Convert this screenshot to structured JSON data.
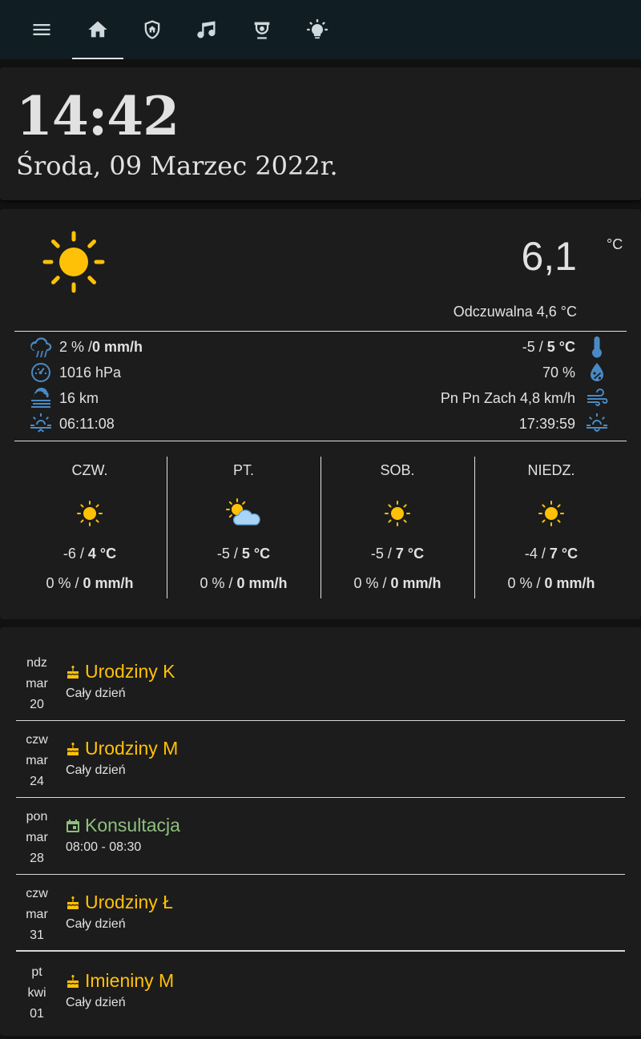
{
  "colors": {
    "topbar": "#101e24",
    "card": "#1c1c1c",
    "accent_yellow": "#ffc107",
    "accent_green": "#8fbf7f",
    "icon_blue": "#4a8ac4"
  },
  "nav": [
    {
      "icon": "menu-icon"
    },
    {
      "icon": "home-icon",
      "active": true
    },
    {
      "icon": "shield-home-icon"
    },
    {
      "icon": "music-note-icon"
    },
    {
      "icon": "cctv-icon"
    },
    {
      "icon": "lightbulb-icon"
    }
  ],
  "clock": {
    "time": "14:42",
    "date": "Środa, 09 Marzec 2022r."
  },
  "weather": {
    "condition_icon": "sunny-icon",
    "temperature": "6,1",
    "unit": "°C",
    "feels_like": "Odczuwalna 4,6 °C",
    "attrs_left": [
      {
        "icon": "rain-probability-icon",
        "text": "2 % / ",
        "bold": "0 mm/h"
      },
      {
        "icon": "pressure-gauge-icon",
        "text": "1016 hPa",
        "bold": ""
      },
      {
        "icon": "visibility-fog-icon",
        "text": "16 km",
        "bold": ""
      },
      {
        "icon": "sunrise-icon",
        "text": "06:11:08",
        "bold": ""
      }
    ],
    "attrs_right": [
      {
        "icon": "thermometer-icon",
        "text": "-5 / ",
        "bold": "5 °C"
      },
      {
        "icon": "humidity-icon",
        "text": "70 %",
        "bold": ""
      },
      {
        "icon": "wind-icon",
        "text": "Pn Pn Zach 4,8 km/h",
        "bold": ""
      },
      {
        "icon": "sunset-icon",
        "text": "17:39:59",
        "bold": ""
      }
    ],
    "forecast": [
      {
        "day": "CZW.",
        "icon": "sunny-icon",
        "low": "-6 / ",
        "high": "4 °C",
        "precip": "0 % / ",
        "precip_bold": "0 mm/h"
      },
      {
        "day": "PT.",
        "icon": "partly-cloudy-icon",
        "low": "-5 / ",
        "high": "5 °C",
        "precip": "0 % / ",
        "precip_bold": "0 mm/h"
      },
      {
        "day": "SOB.",
        "icon": "sunny-icon",
        "low": "-5 / ",
        "high": "7 °C",
        "precip": "0 % / ",
        "precip_bold": "0 mm/h"
      },
      {
        "day": "NIEDZ.",
        "icon": "sunny-icon",
        "low": "-4 / ",
        "high": "7 °C",
        "precip": "0 % / ",
        "precip_bold": "0 mm/h"
      }
    ]
  },
  "calendar": {
    "events": [
      {
        "dow": "ndz",
        "month": "mar",
        "day": "20",
        "icon": "cake-icon",
        "title": "Urodziny K",
        "sub": "Cały dzień",
        "color": "#ffc107"
      },
      {
        "dow": "czw",
        "month": "mar",
        "day": "24",
        "icon": "cake-icon",
        "title": "Urodziny M",
        "sub": "Cały dzień",
        "color": "#ffc107"
      },
      {
        "dow": "pon",
        "month": "mar",
        "day": "28",
        "icon": "calendar-icon",
        "title": "Konsultacja",
        "sub": "08:00 - 08:30",
        "color": "#8fbf7f"
      },
      {
        "dow": "czw",
        "month": "mar",
        "day": "31",
        "icon": "cake-icon",
        "title": "Urodziny Ł",
        "sub": "Cały dzień",
        "color": "#ffc107"
      },
      {
        "dow": "pt",
        "month": "kwi",
        "day": "01",
        "icon": "cake-icon",
        "title": "Imieniny M",
        "sub": "Cały dzień",
        "color": "#ffc107"
      }
    ]
  }
}
